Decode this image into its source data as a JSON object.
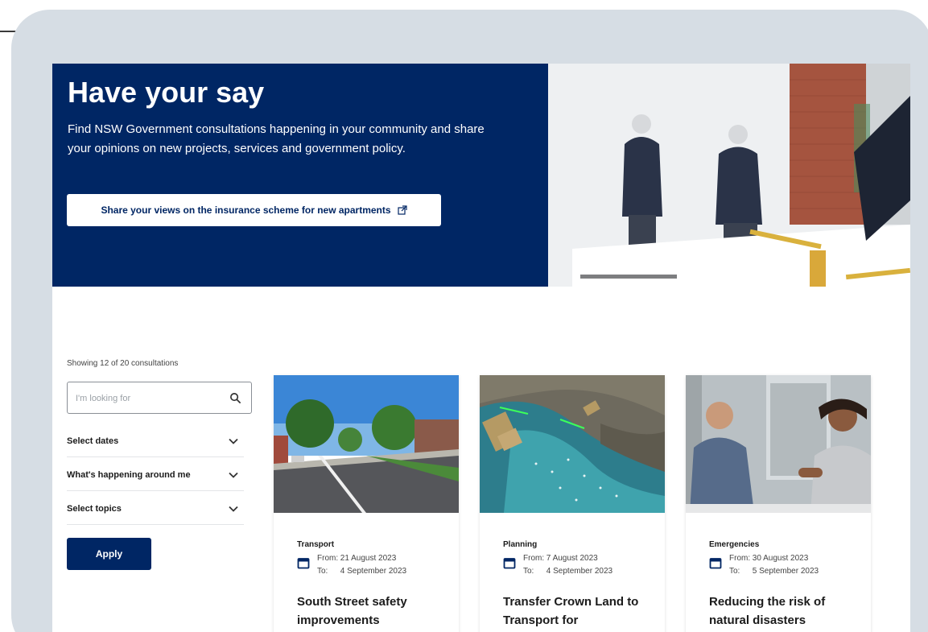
{
  "hero": {
    "title": "Have your say",
    "description": "Find NSW Government consultations happening in your community and share your opinions on new projects, services and government policy.",
    "cta_label": "Share your views on the insurance scheme for new apartments"
  },
  "results": {
    "showing_text": "Showing 12 of 20 consultations"
  },
  "search": {
    "placeholder": "I'm looking for"
  },
  "filters": [
    {
      "label": "Select dates"
    },
    {
      "label": "What's happening around me"
    },
    {
      "label": "Select topics"
    }
  ],
  "apply_label": "Apply",
  "cards": [
    {
      "topic": "Transport",
      "from_label": "From:",
      "from_date": "21 August 2023",
      "to_label": "To:",
      "to_date": "4 September 2023",
      "title": "South Street safety improvements"
    },
    {
      "topic": "Planning",
      "from_label": "From:",
      "from_date": "7 August 2023",
      "to_label": "To:",
      "to_date": "4 September 2023",
      "title": "Transfer Crown Land to Transport for"
    },
    {
      "topic": "Emergencies",
      "from_label": "From:",
      "from_date": "30 August 2023",
      "to_label": "To:",
      "to_date": "5 September 2023",
      "title": "Reducing the risk of natural disasters"
    }
  ],
  "colors": {
    "brand_navy": "#002664",
    "frame": "#d6dde4",
    "text": "#1b1b1b"
  },
  "icons": {
    "search": "search-icon",
    "chevron": "chevron-down-icon",
    "calendar": "calendar-icon",
    "external": "external-link-icon"
  }
}
